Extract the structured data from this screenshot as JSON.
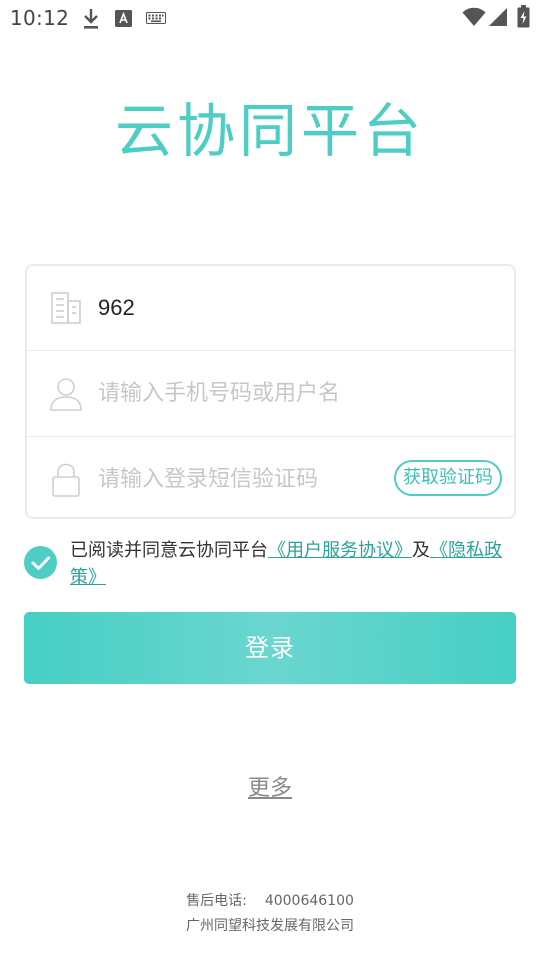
{
  "status_bar": {
    "time": "10:12",
    "icons": [
      "download-icon",
      "text-a-icon",
      "keyboard-icon",
      "wifi-icon",
      "signal-icon",
      "battery-icon"
    ]
  },
  "title": "云协同平台",
  "form": {
    "company_value": "962",
    "username_placeholder": "请输入手机号码或用户名",
    "code_placeholder": "请输入登录短信验证码",
    "code_button": "获取验证码"
  },
  "agreement": {
    "prefix": "已阅读并同意云协同平台",
    "user_agreement": "《用户服务协议》",
    "and": "及",
    "privacy_policy": "《隐私政策》",
    "checked": true
  },
  "login_button": "登录",
  "more_link": "更多",
  "footer": {
    "phone_label": "售后电话:",
    "phone_number": "4000646100",
    "company": "广州同望科技发展有限公司"
  },
  "colors": {
    "accent": "#4ecdc4",
    "link": "#2aa39a",
    "placeholder": "#c7c7c7"
  }
}
